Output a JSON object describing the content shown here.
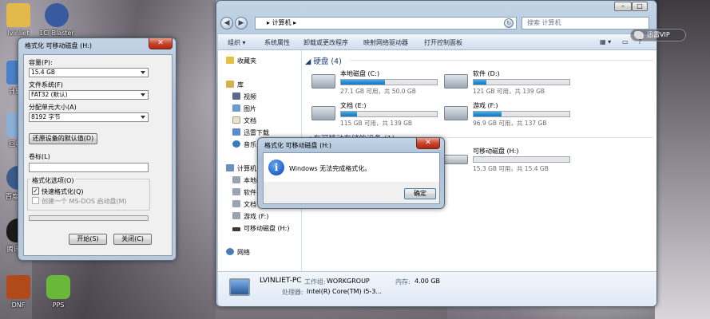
{
  "desktop": {
    "icons": [
      {
        "label": "lvinliet",
        "color": "#e2b94a"
      },
      {
        "label": "1Cl Blaster",
        "color": "#3a5aa0"
      },
      {
        "label": "计算机",
        "color": "#4a80c8"
      },
      {
        "label": "回收站",
        "color": "#8ab0d8"
      },
      {
        "label": "百度影音",
        "color": "#3c5c8c"
      },
      {
        "label": "腾讯QQ",
        "color": "#1a1a1a"
      },
      {
        "label": "DNF",
        "color": "#b04a1a"
      },
      {
        "label": "PPS",
        "color": "#6ab83a"
      }
    ],
    "vip_label": "迅雷VIP"
  },
  "format_dialog": {
    "title": "格式化 可移动磁盘 (H:)",
    "capacity_label": "容量(P):",
    "capacity_value": "15.4 GB",
    "filesystem_label": "文件系统(F)",
    "filesystem_value": "FAT32 (默认)",
    "allocation_label": "分配单元大小(A)",
    "allocation_value": "8192 字节",
    "restore_defaults": "还原设备的默认值(D)",
    "volume_label": "卷标(L)",
    "volume_value": "",
    "options_label": "格式化选项(O)",
    "quick_format": "快速格式化(Q)",
    "quick_format_checked": true,
    "msdos_disk": "创建一个 MS-DOS 启动盘(M)",
    "msdos_checked": false,
    "start_button": "开始(S)",
    "close_button": "关闭(C)"
  },
  "explorer": {
    "breadcrumb_root": "▸",
    "breadcrumb": "计算机",
    "search_placeholder": "搜索 计算机",
    "toolbar": [
      "组织 ▾",
      "系统属性",
      "卸载或更改程序",
      "映射网络驱动器",
      "打开控制面板"
    ],
    "nav": {
      "favorites": "收藏夹",
      "library": "库",
      "library_items": [
        "视频",
        "图片",
        "文档",
        "迅雷下载",
        "音乐"
      ],
      "computer": "计算机",
      "computer_items": [
        "本地磁盘 (C:)",
        "软件 (D:)",
        "文档 (E:)",
        "游戏 (F:)",
        "可移动磁盘 (H:)"
      ],
      "network": "网络"
    },
    "hard_disks_header": "硬盘 (4)",
    "removable_header": "有可移动存储的设备 (1)",
    "drives": [
      {
        "name": "本地磁盘 (C:)",
        "free": "27.1 GB 可用，共 50.0 GB",
        "used_fraction": 0.46
      },
      {
        "name": "软件 (D:)",
        "free": "121 GB 可用，共 139 GB",
        "used_fraction": 0.13
      },
      {
        "name": "文档 (E:)",
        "free": "115 GB 可用，共 139 GB",
        "used_fraction": 0.17
      },
      {
        "name": "游戏 (F:)",
        "free": "96.9 GB 可用，共 137 GB",
        "used_fraction": 0.29
      }
    ],
    "removable": {
      "name": "可移动磁盘 (H:)",
      "free": "15.3 GB 可用，共 15.4 GB",
      "used_fraction": 0.0
    },
    "details": {
      "computer_name": "LVINLIET-PC",
      "workgroup_label": "工作组:",
      "workgroup_value": "WORKGROUP",
      "memory_label": "内存:",
      "memory_value": "4.00 GB",
      "processor_label": "处理器:",
      "processor_value": "Intel(R) Core(TM) i5-3..."
    }
  },
  "message_box": {
    "title": "格式化 可移动磁盘 (H:)",
    "message": "Windows 无法完成格式化。",
    "ok_button": "确定",
    "close_glyph": "✕"
  }
}
